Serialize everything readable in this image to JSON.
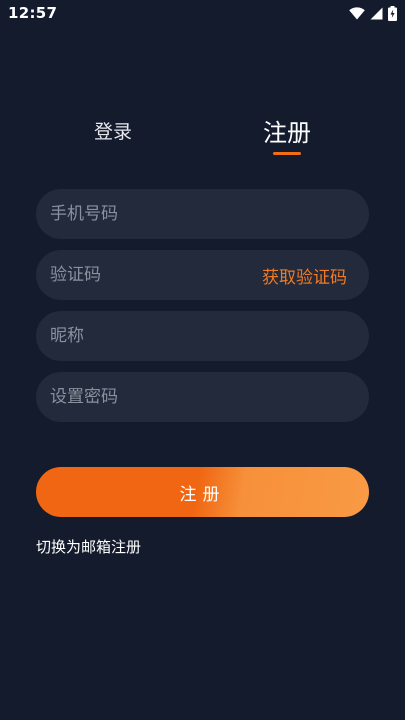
{
  "status_bar": {
    "time": "12:57",
    "icons": [
      "wifi-icon",
      "cellular-signal-icon",
      "battery-icon"
    ]
  },
  "tabs": {
    "login_label": "登录",
    "register_label": "注册",
    "active": "register"
  },
  "form": {
    "phone_placeholder": "手机号码",
    "phone_value": "",
    "code_placeholder": "验证码",
    "code_value": "",
    "get_code_label": "获取验证码",
    "nickname_placeholder": "昵称",
    "nickname_value": "",
    "password_placeholder": "设置密码",
    "password_value": ""
  },
  "submit_label": "注册",
  "switch_email_label": "切换为邮箱注册",
  "colors": {
    "background": "#141b2c",
    "input_background": "#222a3b",
    "accent": "#f26d15",
    "accent_light": "#f99a45",
    "placeholder": "#8a919e"
  }
}
